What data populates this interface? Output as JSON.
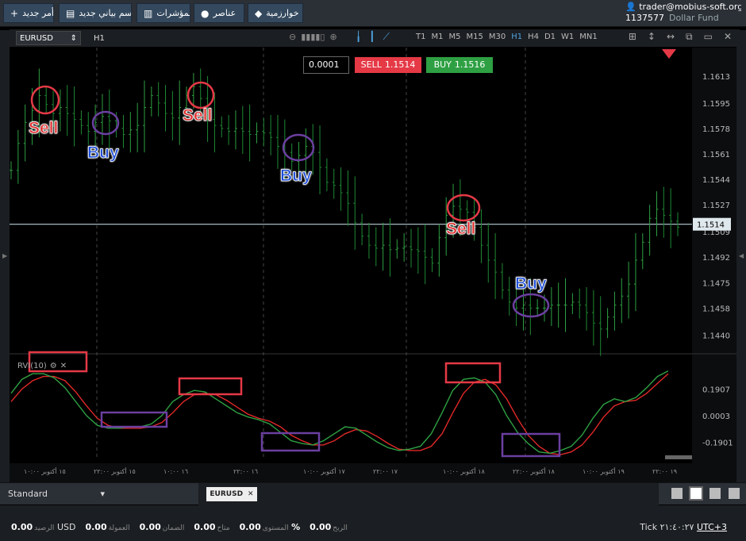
{
  "topbar": {
    "buttons": [
      {
        "label": "أمر جديد",
        "icon": "plus-icon"
      },
      {
        "label": "رسم بياني جديد",
        "icon": "chart-icon"
      },
      {
        "label": "المؤشرات",
        "icon": "bars-icon"
      },
      {
        "label": "عناصر",
        "icon": "shapes-icon"
      },
      {
        "label": "خوارزمية",
        "icon": "diamond-icon"
      }
    ],
    "account": {
      "email": "trader@mobius-soft.org",
      "number": "1137577",
      "name": "Dollar Fund"
    }
  },
  "toolbar": {
    "symbol": "EURUSD",
    "timeframe": "H1",
    "periods": [
      "T1",
      "M1",
      "M5",
      "M15",
      "M30",
      "H1",
      "H4",
      "D1",
      "W1",
      "MN1"
    ],
    "active_period": "H1"
  },
  "trade": {
    "quantity": "0.0001",
    "sell_label": "SELL",
    "sell_price": "1.1514",
    "buy_label": "BUY",
    "buy_price": "1.1516"
  },
  "colors": {
    "up": "#2ea043",
    "down": "#e53946",
    "bg": "#000000",
    "annotation_red": "#e53946",
    "annotation_purple": "#6b3fa0"
  },
  "annotations": {
    "sell_labels": [
      "Sell",
      "Sell",
      "Sell"
    ],
    "buy_labels": [
      "Buy",
      "Buy",
      "Buy"
    ]
  },
  "indicator": {
    "label": "RVI(10)"
  },
  "chart_data": {
    "type": "line",
    "symbol": "EURUSD",
    "price_axis": [
      1.1613,
      1.1595,
      1.1578,
      1.1561,
      1.1544,
      1.1527,
      1.1509,
      1.1492,
      1.1475,
      1.1458,
      1.144
    ],
    "current_price": 1.1514,
    "ylim": [
      1.1428,
      1.1632
    ],
    "x_tick_labels": [
      "١٥ أكتوبر ١٠:٠٠",
      "١٥ أكتوبر ٢٢:٠٠",
      "١٦ ١٠:٠٠",
      "١٦ ٢٢:٠٠",
      "١٧ أكتوبر ١٠:٠٠",
      "١٧ ٢٢:٠٠",
      "١٨ أكتوبر ١٠:٠٠",
      "١٨ أكتوبر ٢٢:٠٠",
      "١٩ أكتوبر ١٠:٠٠",
      "١٩ ٢٢:٠٠"
    ],
    "price_series": [
      1.155,
      1.1568,
      1.1582,
      1.159,
      1.16,
      1.1594,
      1.1588,
      1.1592,
      1.1588,
      1.1584,
      1.158,
      1.1576,
      1.1582,
      1.1586,
      1.1583,
      1.1578,
      1.1574,
      1.1577,
      1.158,
      1.1592,
      1.16,
      1.1595,
      1.1588,
      1.1585,
      1.1592,
      1.16,
      1.1606,
      1.1598,
      1.1584,
      1.158,
      1.1578,
      1.1576,
      1.1578,
      1.1576,
      1.1574,
      1.1576,
      1.1575,
      1.1572,
      1.1566,
      1.1562,
      1.1556,
      1.156,
      1.1566,
      1.1562,
      1.1552,
      1.1542,
      1.154,
      1.1535,
      1.1528,
      1.1515,
      1.1506,
      1.15,
      1.1498,
      1.15,
      1.1497,
      1.1498,
      1.1499,
      1.1497,
      1.1496,
      1.1492,
      1.1488,
      1.1505,
      1.152,
      1.1526,
      1.1524,
      1.1522,
      1.1512,
      1.15,
      1.149,
      1.1482,
      1.147,
      1.1462,
      1.1458,
      1.146,
      1.1458,
      1.1458,
      1.1458,
      1.146,
      1.146,
      1.146,
      1.1462,
      1.146,
      1.1455,
      1.1448,
      1.1444,
      1.1452,
      1.146,
      1.1466,
      1.1474,
      1.149,
      1.1502,
      1.1518,
      1.1524,
      1.152,
      1.1516,
      1.1512
    ],
    "rvi_axis": [
      0.1907,
      0.0003,
      -0.1901
    ],
    "rvi_ylim": [
      -0.33,
      0.42
    ],
    "rvi_green": [
      0.16,
      0.26,
      0.3,
      0.3,
      0.27,
      0.2,
      0.1,
      0.0,
      -0.07,
      -0.09,
      -0.09,
      -0.08,
      -0.08,
      -0.06,
      0.0,
      0.1,
      0.15,
      0.18,
      0.17,
      0.12,
      0.07,
      0.02,
      -0.01,
      -0.03,
      -0.06,
      -0.12,
      -0.18,
      -0.2,
      -0.21,
      -0.18,
      -0.13,
      -0.08,
      -0.09,
      -0.14,
      -0.19,
      -0.23,
      -0.25,
      -0.24,
      -0.22,
      -0.13,
      0.02,
      0.18,
      0.26,
      0.27,
      0.24,
      0.15,
      0.0,
      -0.12,
      -0.2,
      -0.26,
      -0.27,
      -0.25,
      -0.22,
      -0.14,
      -0.02,
      0.08,
      0.12,
      0.1,
      0.13,
      0.2,
      0.28,
      0.32
    ],
    "rvi_red": [
      0.1,
      0.19,
      0.25,
      0.28,
      0.28,
      0.25,
      0.17,
      0.07,
      -0.02,
      -0.07,
      -0.09,
      -0.09,
      -0.09,
      -0.08,
      -0.05,
      0.02,
      0.1,
      0.15,
      0.16,
      0.15,
      0.11,
      0.06,
      0.01,
      -0.02,
      -0.04,
      -0.08,
      -0.14,
      -0.18,
      -0.21,
      -0.21,
      -0.18,
      -0.13,
      -0.1,
      -0.11,
      -0.15,
      -0.2,
      -0.24,
      -0.25,
      -0.25,
      -0.22,
      -0.13,
      0.02,
      0.16,
      0.24,
      0.26,
      0.22,
      0.12,
      -0.02,
      -0.14,
      -0.22,
      -0.27,
      -0.28,
      -0.26,
      -0.21,
      -0.12,
      -0.01,
      0.07,
      0.1,
      0.11,
      0.16,
      0.23,
      0.3
    ]
  },
  "bottombar": {
    "template": "Standard",
    "symbol_tab": "EURUSD"
  },
  "status": {
    "balance_value": "0.00",
    "balance_label": "الرصيد",
    "currency": "USD",
    "commission_value": "0.00",
    "commission_label": "العمولة",
    "margin_value": "0.00",
    "margin_label": "الضمان",
    "free_value": "0.00",
    "free_label": "متاح",
    "level_value": "0.00",
    "level_label": "المستوى",
    "level_unit": "%",
    "profit_value": "0.00",
    "profit_label": "الربح",
    "tick_label": "Tick",
    "time": "٢١:٤٠:٢٧",
    "timezone": "UTC+3"
  }
}
